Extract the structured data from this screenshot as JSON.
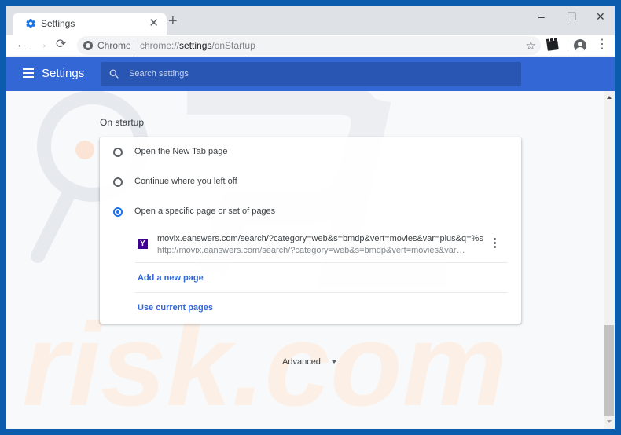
{
  "browser": {
    "tab": {
      "title": "Settings",
      "icon": "gear-icon",
      "close_glyph": "✕"
    },
    "new_tab_glyph": "+",
    "window_controls": {
      "minimize": "–",
      "maximize": "☐",
      "close": "✕"
    },
    "nav": {
      "back": "←",
      "forward": "→",
      "reload": "⟳"
    },
    "omnibox": {
      "chip": "Chrome",
      "url_scheme": "chrome://",
      "url_host": "settings",
      "url_path": "/onStartup",
      "star_glyph": "☆"
    },
    "menu_glyph": "⋮"
  },
  "settings_header": {
    "title": "Settings",
    "search_placeholder": "Search settings"
  },
  "on_startup": {
    "section_title": "On startup",
    "options": [
      {
        "label": "Open the New Tab page",
        "checked": false
      },
      {
        "label": "Continue where you left off",
        "checked": false
      },
      {
        "label": "Open a specific page or set of pages",
        "checked": true
      }
    ],
    "pages": [
      {
        "favicon_letter": "Y",
        "title": "movix.eanswers.com/search/?category=web&s=bmdp&vert=movies&var=plus&q=%s",
        "url": "http://movix.eanswers.com/search/?category=web&s=bmdp&vert=movies&var=plus&q=%s"
      }
    ],
    "add_page_label": "Add a new page",
    "use_current_label": "Use current pages"
  },
  "advanced_label": "Advanced",
  "colors": {
    "header_blue": "#3367d6",
    "search_blue": "#2a56b3",
    "link_blue": "#3367d6",
    "radio_checked": "#1a73e8",
    "favicon_purple": "#410093"
  }
}
